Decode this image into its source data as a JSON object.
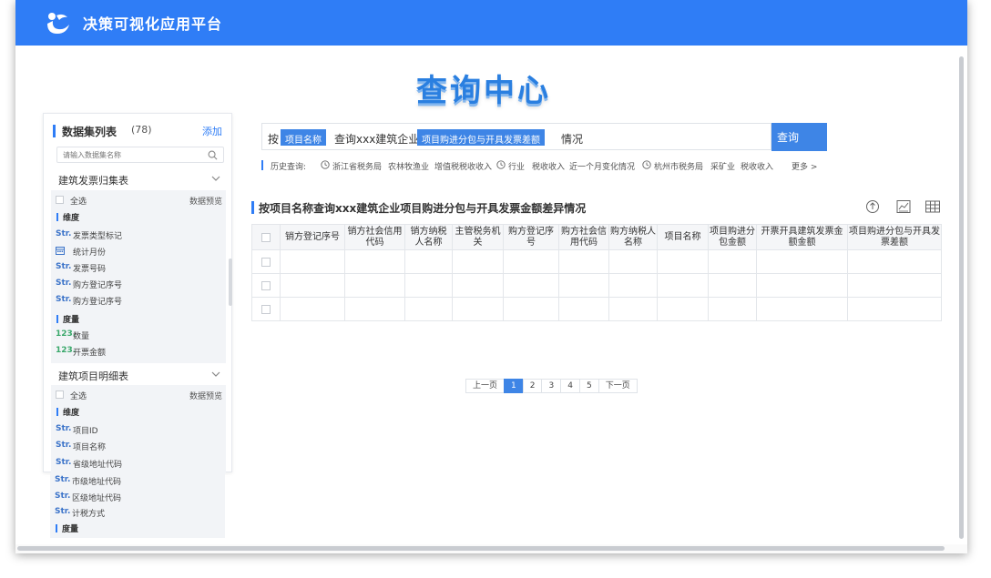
{
  "app": {
    "title": "决策可视化应用平台"
  },
  "hero": {
    "title": "查询中心"
  },
  "panel": {
    "title": "数据集列表",
    "count": "(78)",
    "add_label": "添加",
    "search_placeholder": "请输入数据集名称",
    "groups": [
      {
        "name": "建筑发票归集表",
        "select_all": "全选",
        "preview": "数据预览",
        "dimension_label": "维度",
        "dimensions": [
          {
            "type": "Str.",
            "name": "发票类型标记"
          },
          {
            "type": "calendar-icon",
            "name": "统计月份"
          },
          {
            "type": "Str.",
            "name": "发票号码"
          },
          {
            "type": "Str.",
            "name": "购方登记序号"
          },
          {
            "type": "Str.",
            "name": "购方登记序号"
          }
        ],
        "measure_label": "度量",
        "measures": [
          {
            "type": "123.",
            "name": "数量"
          },
          {
            "type": "123.",
            "name": "开票金额"
          }
        ]
      },
      {
        "name": "建筑项目明细表",
        "select_all": "全选",
        "preview": "数据预览",
        "dimension_label": "维度",
        "dimensions": [
          {
            "type": "Str.",
            "name": "项目ID"
          },
          {
            "type": "Str.",
            "name": "项目名称"
          },
          {
            "type": "Str.",
            "name": "省级地址代码"
          },
          {
            "type": "Str.",
            "name": "市级地址代码"
          },
          {
            "type": "Str.",
            "name": "区级地址代码"
          },
          {
            "type": "Str.",
            "name": "计税方式"
          }
        ],
        "measure_label": "度量"
      }
    ]
  },
  "query": {
    "by": "按",
    "chip1": "项目名称",
    "text1": "查询xxx建筑企业",
    "chip2": "项目购进分包与开具发票差额",
    "text2": "情况",
    "button": "查询"
  },
  "history": {
    "label": "历史查询:",
    "items": [
      "浙江省税务局",
      "农林牧渔业",
      "增值税税收收入",
      "行业",
      "税收收入",
      "近一个月变化情况",
      "杭州市税务局",
      "采矿业",
      "税收收入"
    ],
    "more": "更多 >"
  },
  "result": {
    "title": "按项目名称查询xxx建筑企业项目购进分包与开具发票金额差异情况",
    "columns": [
      "销方登记序号",
      "销方社会信用代码",
      "销方纳税人名称",
      "主管税务机关",
      "购方登记序号",
      "购方社会信用代码",
      "购方纳税人名称",
      "项目名称",
      "项目购进分包金额",
      "开票开具建筑发票金额金额",
      "项目购进分包与开具发票差额"
    ],
    "rows": 3
  },
  "pager": {
    "prev": "上一页",
    "pages": [
      "1",
      "2",
      "3",
      "4",
      "5"
    ],
    "active": "1",
    "next": "下一页"
  },
  "colors": {
    "brand": "#2f7df6",
    "accent": "#3e85e6",
    "str_tag": "#3b73c9",
    "num_tag": "#3aa86b"
  }
}
